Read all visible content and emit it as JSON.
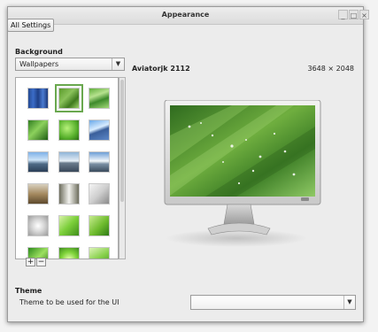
{
  "window": {
    "title": "Appearance"
  },
  "titlebar_buttons": [
    "_",
    "□",
    "×"
  ],
  "toolbar": {
    "all_settings_label": "All Settings"
  },
  "background": {
    "section_label": "Background",
    "source_combo": {
      "selected": "Wallpapers",
      "arrow": "▼"
    },
    "thumbnails": [
      {
        "name": "thumb-blue-stripes",
        "selected": false
      },
      {
        "name": "thumb-green-leaf-drops",
        "selected": true
      },
      {
        "name": "thumb-green-blades",
        "selected": false
      },
      {
        "name": "thumb-green-leaf",
        "selected": false
      },
      {
        "name": "thumb-green-macro",
        "selected": false
      },
      {
        "name": "thumb-blue-mountain",
        "selected": false
      },
      {
        "name": "thumb-lake-rocks",
        "selected": false
      },
      {
        "name": "thumb-boats",
        "selected": false
      },
      {
        "name": "thumb-snowy-mountain",
        "selected": false
      },
      {
        "name": "thumb-grass-field",
        "selected": false
      },
      {
        "name": "thumb-waterfall",
        "selected": false
      },
      {
        "name": "thumb-grey-bird",
        "selected": false
      },
      {
        "name": "thumb-white-flower",
        "selected": false
      },
      {
        "name": "thumb-green-plant",
        "selected": false
      },
      {
        "name": "thumb-green-swirl",
        "selected": false
      },
      {
        "name": "thumb-green-wave",
        "selected": false
      },
      {
        "name": "thumb-green-light",
        "selected": false
      },
      {
        "name": "thumb-green-rays",
        "selected": false
      }
    ],
    "add_label": "+",
    "remove_label": "−",
    "wallpaper_name": "Aviatorjk 2112",
    "wallpaper_size": "3648 × 2048"
  },
  "theme": {
    "section_label": "Theme",
    "description": "Theme to be used for the UI",
    "selected": "",
    "arrow": "▼"
  },
  "colors": {
    "selection_accent": "#6aa84f",
    "window_bg": "#ececec"
  }
}
